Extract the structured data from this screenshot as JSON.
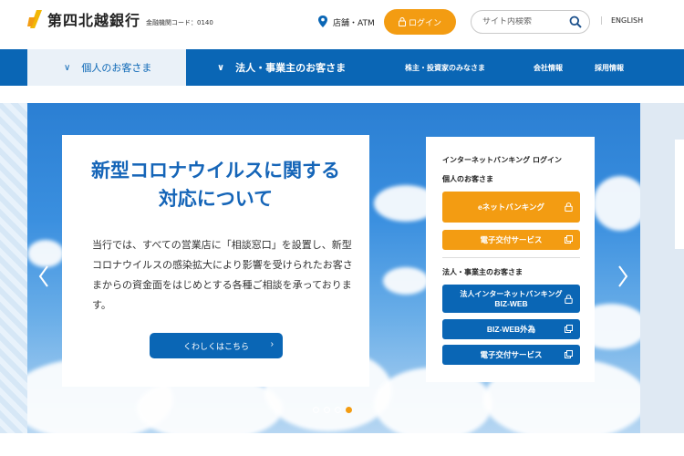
{
  "header": {
    "bank_name": "第四北越銀行",
    "fin_code": "金融機関コード：0140",
    "atm_label": "店舗・ATM",
    "login_label": "ログイン",
    "search_placeholder": "サイト内検索",
    "english_label": "ENGLISH"
  },
  "nav": {
    "personal": "個人のお客さま",
    "corporate": "法人・事業主のお客さま",
    "investors": "株主・投資家のみなさま",
    "company": "会社情報",
    "recruit": "採用情報"
  },
  "hero": {
    "title_line1": "新型コロナウイルスに関する",
    "title_line2": "対応について",
    "body": "当行では、すべての営業店に「相談窓口」を設置し、新型コロナウイルスの感染拡大により影響を受けられたお客さまからの資金面をはじめとする各種ご相談を承っております。",
    "detail_button": "くわしくはこちら",
    "slides": 4,
    "active_slide": 4
  },
  "login_card": {
    "title": "インターネットバンキング ログイン",
    "personal_heading": "個人のお客さま",
    "enet": "eネットバンキング",
    "edoc_personal": "電子交付サービス",
    "corp_heading": "法人・事業主のお客さま",
    "bizweb_line1": "法人インターネットバンキング",
    "bizweb_line2": "BIZ-WEB",
    "bizweb_fx": "BIZ-WEB外為",
    "edoc_corp": "電子交付サービス"
  },
  "colors": {
    "brand_blue": "#0a66b5",
    "accent_orange": "#f39c12"
  }
}
